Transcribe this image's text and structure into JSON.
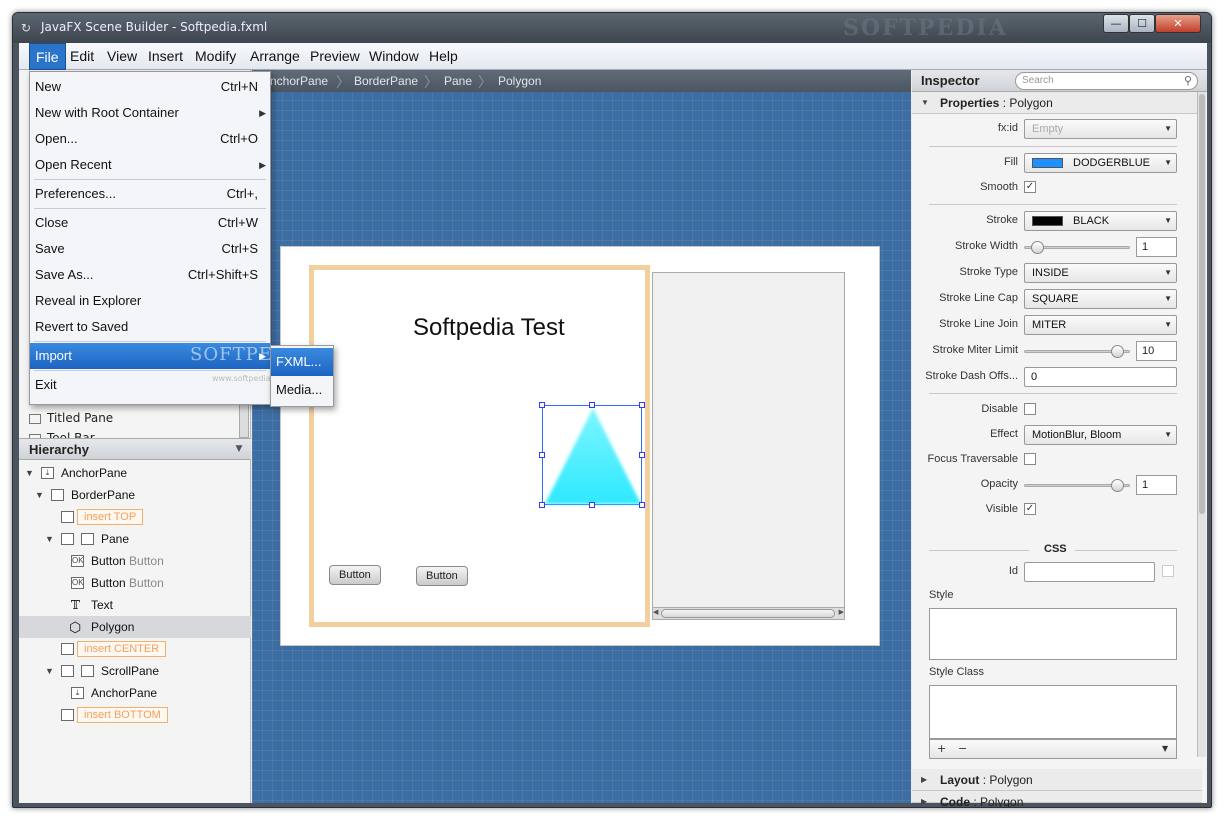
{
  "window": {
    "title": "JavaFX Scene Builder - Softpedia.fxml",
    "watermark": "SOFTPEDIA",
    "controls": {
      "minimize": "—",
      "maximize": "☐",
      "close": "✕"
    }
  },
  "menubar": {
    "items": [
      "File",
      "Edit",
      "View",
      "Insert",
      "Modify",
      "Arrange",
      "Preview",
      "Window",
      "Help"
    ]
  },
  "file_menu": {
    "items": [
      {
        "label": "New",
        "shortcut": "Ctrl+N"
      },
      {
        "label": "New with Root Container",
        "submenu": true
      },
      {
        "label": "Open...",
        "shortcut": "Ctrl+O"
      },
      {
        "label": "Open Recent",
        "submenu": true
      },
      {
        "label": "Preferences...",
        "shortcut": "Ctrl+,"
      },
      {
        "label": "Close",
        "shortcut": "Ctrl+W"
      },
      {
        "label": "Save",
        "shortcut": "Ctrl+S"
      },
      {
        "label": "Save As...",
        "shortcut": "Ctrl+Shift+S"
      },
      {
        "label": "Reveal in Explorer"
      },
      {
        "label": "Revert to Saved"
      },
      {
        "label": "Import",
        "submenu": true
      },
      {
        "label": "Exit"
      }
    ],
    "watermark": "SOFTPEDIA",
    "watermark_small": "www.softpedia.com"
  },
  "import_submenu": {
    "items": [
      "FXML...",
      "Media..."
    ]
  },
  "library": {
    "items": [
      "Titled Pane",
      "Tool Bar"
    ]
  },
  "hierarchy": {
    "title": "Hierarchy",
    "nodes": [
      {
        "label": "AnchorPane"
      },
      {
        "label": "BorderPane"
      },
      {
        "label": "insert TOP"
      },
      {
        "label": "Pane"
      },
      {
        "label": "Button",
        "sub": "Button"
      },
      {
        "label": "Button",
        "sub": "Button"
      },
      {
        "label": "Text"
      },
      {
        "label": "Polygon"
      },
      {
        "label": "insert CENTER"
      },
      {
        "label": "ScrollPane"
      },
      {
        "label": "AnchorPane"
      },
      {
        "label": "insert BOTTOM"
      }
    ]
  },
  "breadcrumb": [
    "AnchorPane",
    "BorderPane",
    "Pane",
    "Polygon"
  ],
  "canvas": {
    "text": "Softpedia Test",
    "button1": "Button",
    "button2": "Button"
  },
  "inspector": {
    "title": "Inspector",
    "search_placeholder": "Search",
    "properties_section": {
      "title": "Properties",
      "target": ": Polygon"
    },
    "fxid": {
      "label": "fx:id",
      "placeholder": "Empty"
    },
    "fill": {
      "label": "Fill",
      "value": "DODGERBLUE",
      "color": "#1e90ff"
    },
    "smooth": {
      "label": "Smooth",
      "checked": "✓"
    },
    "stroke": {
      "label": "Stroke",
      "value": "BLACK",
      "color": "#000000"
    },
    "stroke_width": {
      "label": "Stroke Width",
      "value": "1",
      "level": 0.07
    },
    "stroke_type": {
      "label": "Stroke Type",
      "value": "INSIDE"
    },
    "stroke_line_cap": {
      "label": "Stroke Line Cap",
      "value": "SQUARE"
    },
    "stroke_line_join": {
      "label": "Stroke Line Join",
      "value": "MITER"
    },
    "stroke_miter_limit": {
      "label": "Stroke Miter Limit",
      "value": "10",
      "level": 0.95
    },
    "stroke_dash_offset": {
      "label": "Stroke Dash Offs...",
      "value": "0"
    },
    "disable": {
      "label": "Disable"
    },
    "effect": {
      "label": "Effect",
      "value": "MotionBlur, Bloom"
    },
    "focus_traversable": {
      "label": "Focus Traversable"
    },
    "opacity": {
      "label": "Opacity",
      "value": "1",
      "level": 0.95
    },
    "visible": {
      "label": "Visible",
      "checked": "✓"
    },
    "css_title": "CSS",
    "id": {
      "label": "Id"
    },
    "style": {
      "label": "Style"
    },
    "style_class": {
      "label": "Style Class"
    },
    "plus": "+",
    "minus": "−",
    "layout_section": {
      "title": "Layout",
      "target": ": Polygon"
    },
    "code_section": {
      "title": "Code",
      "target": ": Polygon"
    }
  },
  "colors": {
    "accent": "#2a74c9",
    "polygon_fill": "#40f0ff",
    "canvas_bg": "#3d6ea3"
  }
}
